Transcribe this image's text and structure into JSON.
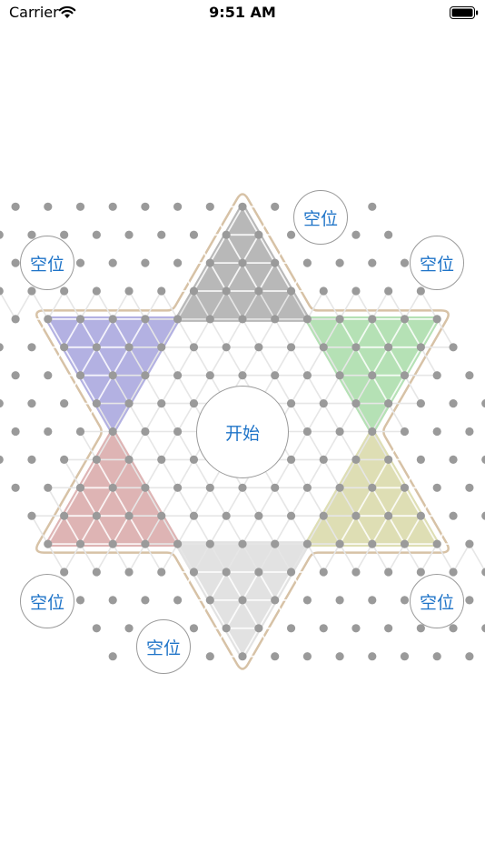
{
  "status_bar": {
    "carrier": "Carrier",
    "time": "9:51 AM",
    "wifi_icon": "wifi-icon",
    "battery_icon": "battery-full-icon"
  },
  "seats": [
    {
      "id": "top-right",
      "label": "空位"
    },
    {
      "id": "upper-left",
      "label": "空位"
    },
    {
      "id": "upper-right",
      "label": "空位"
    },
    {
      "id": "lower-left",
      "label": "空位"
    },
    {
      "id": "lower-right",
      "label": "空位"
    },
    {
      "id": "bottom-left",
      "label": "空位"
    }
  ],
  "start_button": {
    "label": "开始"
  },
  "board": {
    "type": "chinese-checkers",
    "corners": [
      {
        "id": "top",
        "color": "#b8b8b8"
      },
      {
        "id": "top-left",
        "color": "#b3b1e2"
      },
      {
        "id": "top-right",
        "color": "#b5e1b5"
      },
      {
        "id": "bottom-left",
        "color": "#deb4b4"
      },
      {
        "id": "bottom-right",
        "color": "#dedeb4"
      },
      {
        "id": "bottom",
        "color": "#e2e2e2"
      }
    ],
    "outline_color": "#d7c2a6",
    "grid_line_color": "#e6e6e6",
    "hole_color": "#9a9a9a"
  }
}
